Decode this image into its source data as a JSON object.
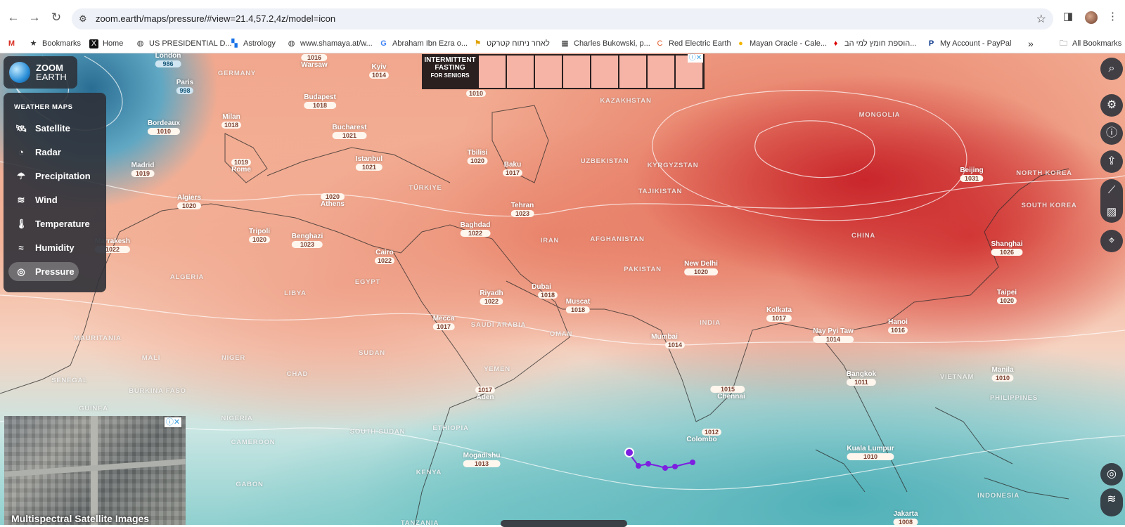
{
  "browser": {
    "url": "zoom.earth/maps/pressure/#view=21.4,57.2,4z/model=icon",
    "bookmarks": [
      {
        "icon": "gmail-icon",
        "label": ""
      },
      {
        "icon": "star-icon",
        "label": "Bookmarks"
      },
      {
        "icon": "x-icon",
        "label": "Home"
      },
      {
        "icon": "globe-icon",
        "label": "US PRESIDENTIAL D..."
      },
      {
        "icon": "astrology-icon",
        "label": "Astrology"
      },
      {
        "icon": "globe-icon",
        "label": "www.shamaya.at/w..."
      },
      {
        "icon": "google-icon",
        "label": "Abraham Ibn Ezra o..."
      },
      {
        "icon": "site-icon",
        "label": "לאחר ניתוח קטרקט"
      },
      {
        "icon": "site-icon",
        "label": "Charles Bukowski, p..."
      },
      {
        "icon": "site-icon",
        "label": "Red Electric Earth"
      },
      {
        "icon": "site-icon",
        "label": "Mayan Oracle - Cale..."
      },
      {
        "icon": "site-icon",
        "label": "הוספת חומץ למי הב..."
      },
      {
        "icon": "paypal-icon",
        "label": "My Account - PayPal"
      },
      {
        "icon": "chevron-icon",
        "label": "»"
      },
      {
        "icon": "folder-icon",
        "label": "All Bookmarks"
      }
    ]
  },
  "logo": {
    "line1": "ZOOM",
    "line2": "EARTH"
  },
  "menu": {
    "heading": "WEATHER MAPS",
    "items": [
      {
        "label": "Satellite",
        "icon": "satellite-icon"
      },
      {
        "label": "Radar",
        "icon": "radar-icon"
      },
      {
        "label": "Precipitation",
        "icon": "precipitation-icon"
      },
      {
        "label": "Wind",
        "icon": "wind-icon"
      },
      {
        "label": "Temperature",
        "icon": "thermometer-icon"
      },
      {
        "label": "Humidity",
        "icon": "humidity-icon"
      },
      {
        "label": "Pressure",
        "icon": "pressure-icon",
        "active": true
      }
    ]
  },
  "ads": {
    "top_title": "INTERMITTENT FASTING",
    "top_subtitle": "FOR SENIORS",
    "bottom_title": "Multispectral Satellite Images"
  },
  "places": [
    {
      "name": "London",
      "pressure": "986",
      "low": true
    },
    {
      "name": "Paris",
      "pressure": "998",
      "low": true
    },
    {
      "name": "Bordeaux",
      "pressure": "1010"
    },
    {
      "name": "Madrid",
      "pressure": "1019"
    },
    {
      "name": "Milan",
      "pressure": "1018"
    },
    {
      "name": "Rome",
      "pressure": "1019"
    },
    {
      "name": "Algiers",
      "pressure": "1020"
    },
    {
      "name": "Tripoli",
      "pressure": "1020"
    },
    {
      "name": "Benghazi",
      "pressure": "1023"
    },
    {
      "name": "Athens",
      "pressure": "1020"
    },
    {
      "name": "Budapest",
      "pressure": "1018"
    },
    {
      "name": "Bucharest",
      "pressure": "1021"
    },
    {
      "name": "Warsaw",
      "pressure": "1016"
    },
    {
      "name": "Kyiv",
      "pressure": "1014"
    },
    {
      "name": "Istanbul",
      "pressure": "1021"
    },
    {
      "name": "Cairo",
      "pressure": "1022"
    },
    {
      "name": "Tbilisi",
      "pressure": "1020"
    },
    {
      "name": "Baku",
      "pressure": "1017"
    },
    {
      "name": "Tehran",
      "pressure": "1023"
    },
    {
      "name": "Baghdad",
      "pressure": "1022"
    },
    {
      "name": "Riyadh",
      "pressure": "1022"
    },
    {
      "name": "Dubai",
      "pressure": "1018"
    },
    {
      "name": "Muscat",
      "pressure": "1018"
    },
    {
      "name": "Mecca",
      "pressure": "1017"
    },
    {
      "name": "Aden",
      "pressure": "1017"
    },
    {
      "name": "Mogadishu",
      "pressure": "1013"
    },
    {
      "name": "Mumbai",
      "pressure": "1014"
    },
    {
      "name": "New Delhi",
      "pressure": "1020"
    },
    {
      "name": "Chennai",
      "pressure": "1015"
    },
    {
      "name": "Colombo",
      "pressure": "1012"
    },
    {
      "name": "Kolkata",
      "pressure": "1017"
    },
    {
      "name": "Nay Pyi Taw",
      "pressure": "1014"
    },
    {
      "name": "Hanoi",
      "pressure": "1016"
    },
    {
      "name": "Bangkok",
      "pressure": "1011"
    },
    {
      "name": "Kuala Lumpur",
      "pressure": "1010"
    },
    {
      "name": "Manila",
      "pressure": "1010"
    },
    {
      "name": "Taipei",
      "pressure": "1020"
    },
    {
      "name": "Shanghai",
      "pressure": "1026"
    },
    {
      "name": "Beijing",
      "pressure": "1031"
    },
    {
      "name": "Jakarta",
      "pressure": "1008"
    },
    {
      "name": "Marrakesh",
      "pressure": "1022"
    }
  ],
  "countries": [
    "GERMANY",
    "KAZAKHSTAN",
    "MONGOLIA",
    "UZBEKISTAN",
    "KYRGYZSTAN",
    "TAJIKISTAN",
    "TÜRKIYE",
    "IRAN",
    "AFGHANISTAN",
    "PAKISTAN",
    "CHINA",
    "NORTH KOREA",
    "SOUTH KOREA",
    "INDIA",
    "ALGERIA",
    "LIBYA",
    "EGYPT",
    "SAUDI ARABIA",
    "OMAN",
    "YEMEN",
    "SUDAN",
    "MAURITANIA",
    "MALI",
    "NIGER",
    "CHAD",
    "SENEGAL",
    "BURKINA FASO",
    "GUINEA",
    "NIGERIA",
    "CAMEROON",
    "ETHIOPIA",
    "SOUTH SUDAN",
    "KENYA",
    "GABON",
    "TANZANIA",
    "VIETNAM",
    "PHILIPPINES",
    "INDONESIA"
  ],
  "partial_labels": [
    "1016",
    "1010",
    "20"
  ]
}
